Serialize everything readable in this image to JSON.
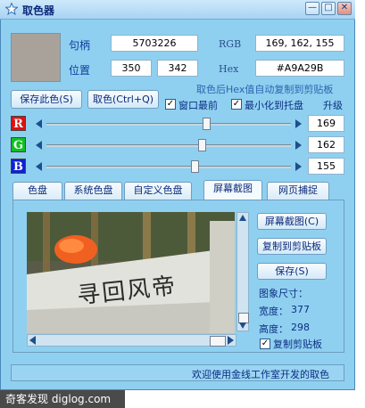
{
  "window": {
    "title": "取色器",
    "app_icon": "star-icon"
  },
  "title_controls": {
    "minimize": "—",
    "maximize": "□",
    "close": "✕"
  },
  "color": {
    "swatch_hex": "#A9A29B"
  },
  "fields": {
    "handle_label": "句柄",
    "handle_value": "5703226",
    "position_label": "位置",
    "pos_x": "350",
    "pos_y": "342",
    "rgb_label": "RGB",
    "rgb_value": "169, 162, 155",
    "hex_label": "Hex",
    "hex_value": "#A9A29B"
  },
  "buttons": {
    "save_color": "保存此色(S)",
    "pick_color": "取色(Ctrl+Q)"
  },
  "hint_autocopy": "取色后Hex值自动复制到剪贴板",
  "checkboxes": {
    "topmost": {
      "label": "窗口最前",
      "checked": true
    },
    "minimize_tray": {
      "label": "最小化到托盘",
      "checked": true
    }
  },
  "upgrade_label": "升级",
  "channels": [
    {
      "label": "R",
      "value": "169",
      "color": "#e01010",
      "level": 0.66
    },
    {
      "label": "G",
      "value": "162",
      "color": "#10c020",
      "level": 0.64
    },
    {
      "label": "B",
      "value": "155",
      "color": "#1020d0",
      "level": 0.61
    }
  ],
  "tabs": [
    "色盘",
    "系统色盘",
    "自定义色盘",
    "屏幕截图",
    "网页捕捉"
  ],
  "active_tab": "屏幕截图",
  "screenshot_panel": {
    "capture_button": "屏幕截图(C)",
    "copy_button": "复制到剪贴板",
    "save_button": "保存(S)",
    "size_label": "图象尺寸：",
    "width_label": "宽度：",
    "width_value": "377",
    "height_label": "高度：",
    "height_value": "298",
    "copy_clipboard_checkbox": {
      "label": "复制剪贴板",
      "checked": true
    },
    "image_text": "寻回风帝"
  },
  "status_text": "欢迎使用金线工作室开发的取色",
  "watermark_text": "奇客发现 diglog.com"
}
